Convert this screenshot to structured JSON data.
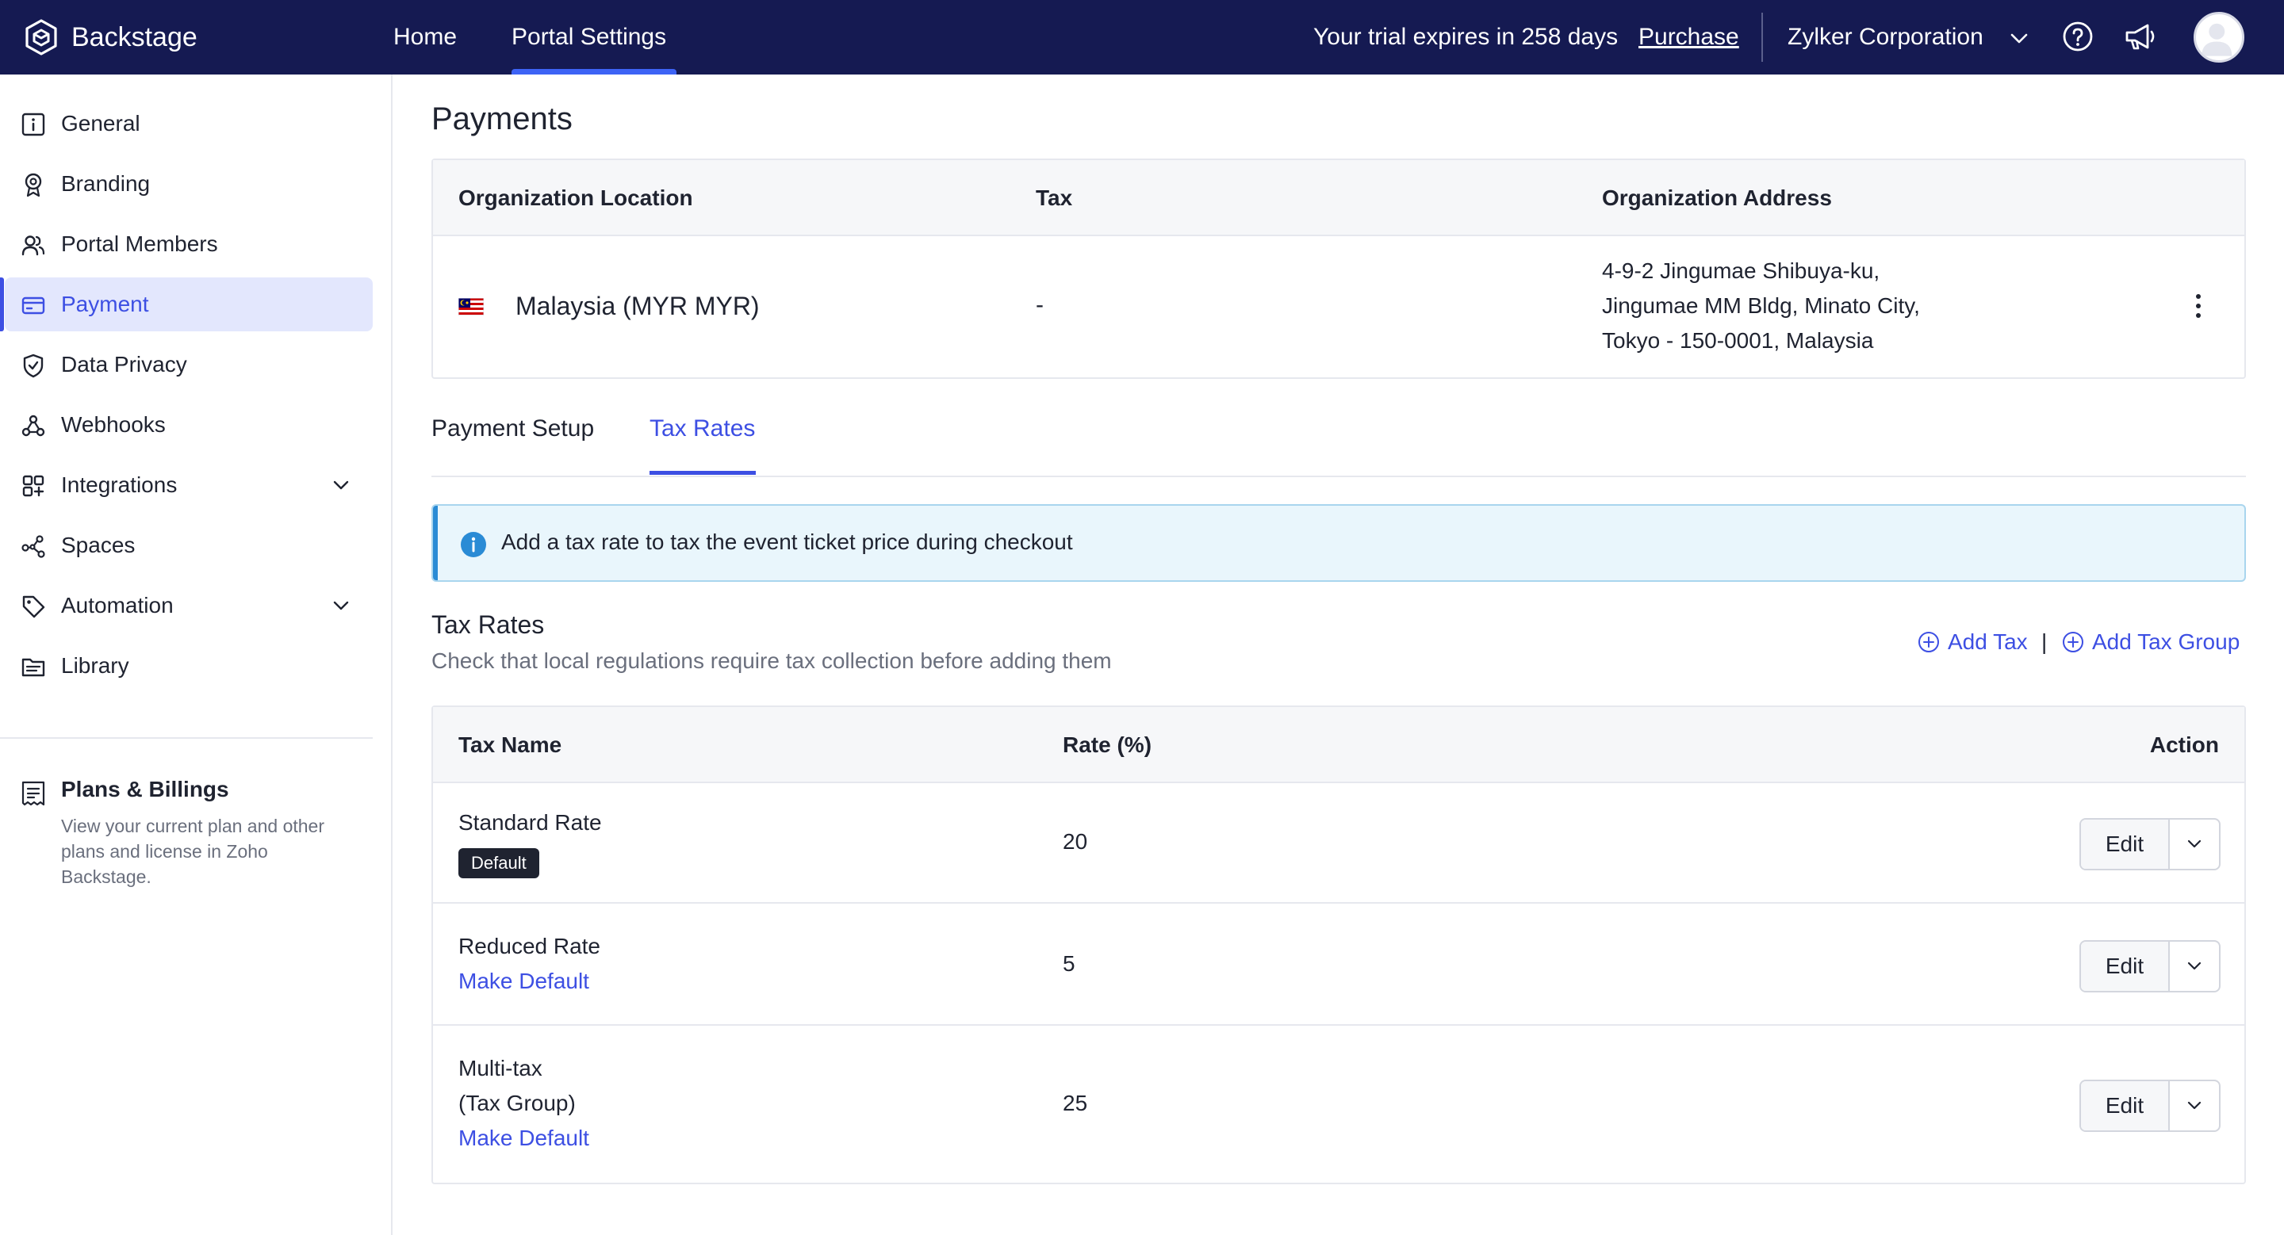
{
  "topbar": {
    "brand": "Backstage",
    "nav": [
      {
        "label": "Home"
      },
      {
        "label": "Portal Settings"
      }
    ],
    "trial_text": "Your trial expires in 258 days",
    "purchase_label": "Purchase",
    "org_name": "Zylker Corporation",
    "icons": [
      "backstage-logo-icon",
      "chevron-down-icon",
      "help-icon",
      "megaphone-icon",
      "avatar"
    ]
  },
  "sidebar": {
    "items": [
      {
        "label": "General",
        "icon": "info-square-icon"
      },
      {
        "label": "Branding",
        "icon": "badge-icon"
      },
      {
        "label": "Portal Members",
        "icon": "users-icon"
      },
      {
        "label": "Payment",
        "icon": "credit-card-icon",
        "active": true
      },
      {
        "label": "Data Privacy",
        "icon": "shield-check-icon"
      },
      {
        "label": "Webhooks",
        "icon": "webhook-icon"
      },
      {
        "label": "Integrations",
        "icon": "grid-icon",
        "expandable": true
      },
      {
        "label": "Spaces",
        "icon": "share-nodes-icon"
      },
      {
        "label": "Automation",
        "icon": "tag-icon",
        "expandable": true
      },
      {
        "label": "Library",
        "icon": "folder-icon"
      }
    ],
    "plans": {
      "title": "Plans & Billings",
      "description": "View your current plan and other plans and license in Zoho Backstage."
    }
  },
  "main": {
    "title": "Payments",
    "org_table": {
      "headers": [
        "Organization Location",
        "Tax",
        "Organization Address"
      ],
      "location": "Malaysia (MYR  MYR)",
      "tax": "-",
      "address_lines": [
        "4-9-2 Jingumae Shibuya-ku,",
        "Jingumae MM Bldg, Minato City,",
        "Tokyo - 150-0001, Malaysia"
      ]
    },
    "tabs": [
      {
        "label": "Payment Setup"
      },
      {
        "label": "Tax Rates",
        "active": true
      }
    ],
    "info_banner": "Add a tax rate to tax the event ticket price during checkout",
    "tax_rates": {
      "title": "Tax Rates",
      "subtitle": "Check that local regulations require tax collection before adding them",
      "add_tax_label": "Add Tax",
      "separator": "|",
      "add_group_label": "Add Tax Group",
      "headers": [
        "Tax Name",
        "Rate (%)",
        "Action"
      ],
      "rows": [
        {
          "name": "Standard Rate",
          "badge": "Default",
          "rate": "20",
          "action": "Edit"
        },
        {
          "name": "Reduced Rate",
          "link": "Make Default",
          "rate": "5",
          "action": "Edit"
        },
        {
          "name": "Multi-tax",
          "name_sub": "(Tax Group)",
          "link": "Make Default",
          "rate": "25",
          "action": "Edit"
        }
      ]
    }
  },
  "colors": {
    "topbar_bg": "#151a52",
    "accent": "#3d4fe3",
    "active_nav_bg": "#e3e7fd",
    "info_bg": "#e9f6fc",
    "info_icon": "#2a8bd5"
  }
}
